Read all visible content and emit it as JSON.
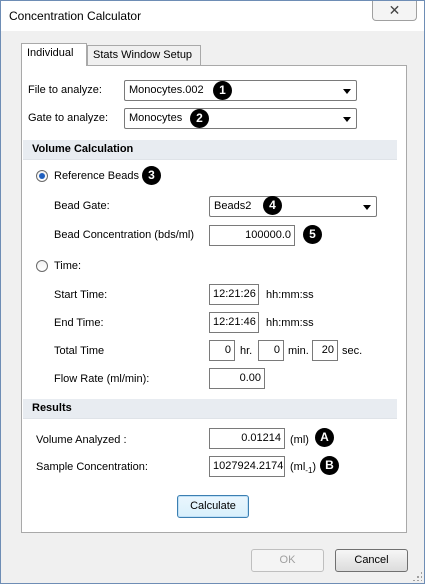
{
  "window": {
    "title": "Concentration Calculator",
    "close_icon": "close-icon"
  },
  "tabs": [
    {
      "label": "Individual",
      "active": true
    },
    {
      "label": "Stats Window Setup",
      "active": false
    }
  ],
  "file_to_analyze": {
    "label": "File to analyze:",
    "value": "Monocytes.002",
    "badge": "1"
  },
  "gate_to_analyze": {
    "label": "Gate to analyze:",
    "value": "Monocytes",
    "badge": "2"
  },
  "volume_calculation": {
    "header": "Volume Calculation",
    "reference_beads": {
      "label": "Reference Beads",
      "selected": true,
      "badge": "3"
    },
    "bead_gate": {
      "label": "Bead Gate:",
      "value": "Beads2",
      "badge": "4"
    },
    "bead_concentration": {
      "label": "Bead Concentration (bds/ml)",
      "value": "100000.0",
      "badge": "5"
    },
    "time": {
      "label": "Time:",
      "selected": false
    },
    "start_time": {
      "label": "Start Time:",
      "value": "12:21:26",
      "unit": "hh:mm:ss"
    },
    "end_time": {
      "label": "End Time:",
      "value": "12:21:46",
      "unit": "hh:mm:ss"
    },
    "total_time": {
      "label": "Total Time",
      "hours": "0",
      "hours_unit": "hr.",
      "minutes": "0",
      "minutes_unit": "min.",
      "seconds": "20",
      "seconds_unit": "sec."
    },
    "flow_rate": {
      "label": "Flow Rate (ml/min):",
      "value": "0.00"
    }
  },
  "results": {
    "header": "Results",
    "volume_analyzed": {
      "label": "Volume Analyzed :",
      "value": "0.01214",
      "unit": "(ml)",
      "badge": "A"
    },
    "sample_concentration": {
      "label": "Sample Concentration:",
      "value": "1027924.2174",
      "unit_prefix": "(ml",
      "unit_sub": "-1",
      "unit_suffix": ")",
      "badge": "B"
    }
  },
  "buttons": {
    "calculate": "Calculate",
    "ok": "OK",
    "cancel": "Cancel"
  },
  "colors": {
    "badge": "#000000",
    "section_header": "#e8ecf1",
    "radio_selected": "#1f5fbf"
  }
}
